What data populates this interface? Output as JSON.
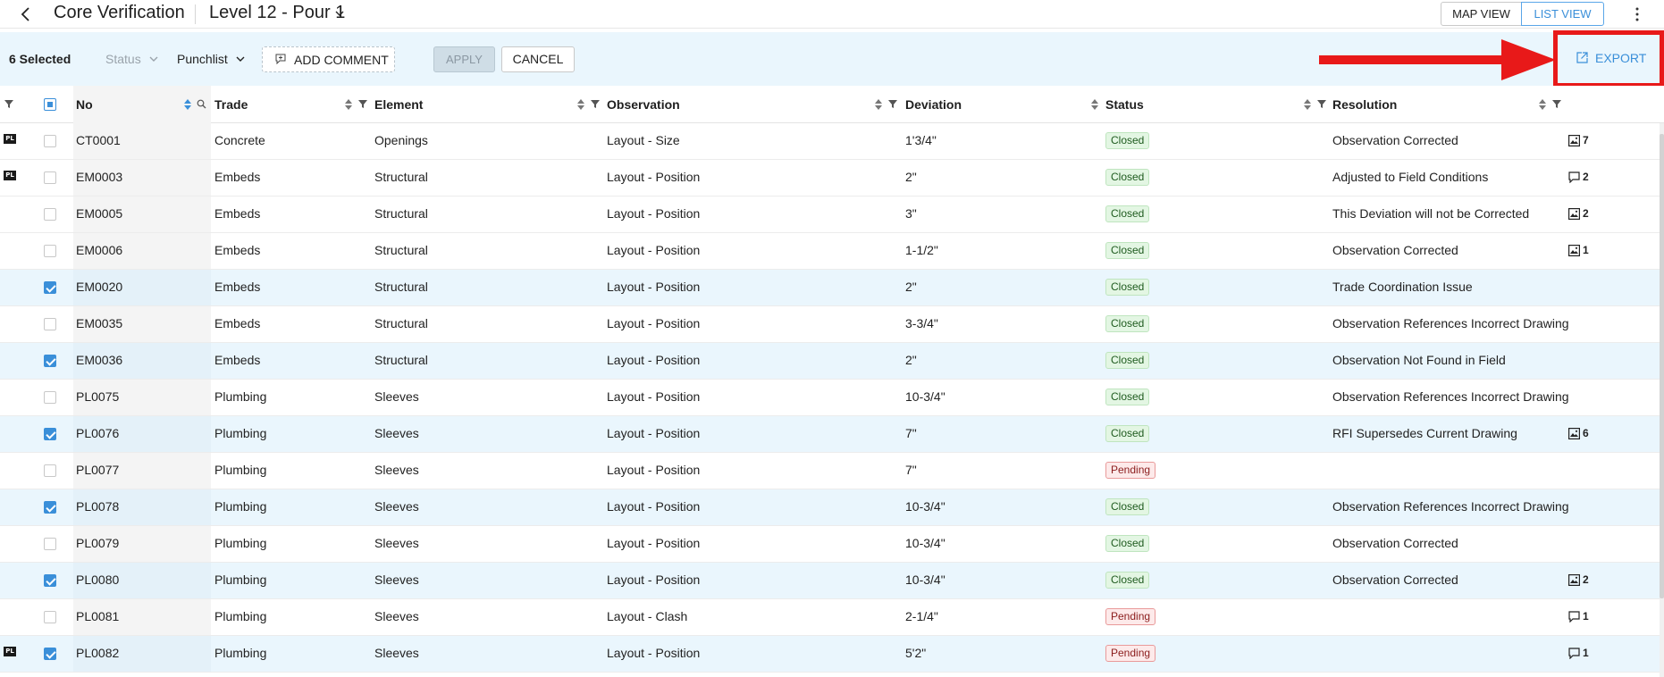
{
  "header": {
    "title": "Core Verification",
    "level": "Level 12 - Pour 1",
    "map_view": "MAP VIEW",
    "list_view": "LIST VIEW"
  },
  "toolbar": {
    "selected": "6 Selected",
    "status": "Status",
    "punchlist": "Punchlist",
    "add_comment": "ADD COMMENT",
    "apply": "APPLY",
    "cancel": "CANCEL",
    "export": "EXPORT"
  },
  "columns": [
    "No",
    "Trade",
    "Element",
    "Observation",
    "Deviation",
    "Status",
    "Resolution"
  ],
  "colors": {
    "accent": "#3a8fd9",
    "selected_row": "#eaf6fd",
    "closed_badge": "#e3f6e3",
    "pending_badge": "#fdeaea",
    "highlight_red": "#e81919"
  },
  "rows": [
    {
      "pl": true,
      "checked": false,
      "no": "CT0001",
      "trade": "Concrete",
      "element": "Openings",
      "observation": "Layout - Size",
      "deviation": "1'3/4\"",
      "status": "Closed",
      "resolution": "Observation Corrected",
      "att_icon": "image-icon",
      "att_count": "7"
    },
    {
      "pl": true,
      "checked": false,
      "no": "EM0003",
      "trade": "Embeds",
      "element": "Structural",
      "observation": "Layout - Position",
      "deviation": "2\"",
      "status": "Closed",
      "resolution": "Adjusted to Field Conditions",
      "att_icon": "comment-icon",
      "att_count": "2"
    },
    {
      "pl": false,
      "checked": false,
      "no": "EM0005",
      "trade": "Embeds",
      "element": "Structural",
      "observation": "Layout - Position",
      "deviation": "3\"",
      "status": "Closed",
      "resolution": "This Deviation will not be Corrected",
      "att_icon": "image-icon",
      "att_count": "2"
    },
    {
      "pl": false,
      "checked": false,
      "no": "EM0006",
      "trade": "Embeds",
      "element": "Structural",
      "observation": "Layout - Position",
      "deviation": "1-1/2\"",
      "status": "Closed",
      "resolution": "Observation Corrected",
      "att_icon": "image-icon",
      "att_count": "1"
    },
    {
      "pl": false,
      "checked": true,
      "no": "EM0020",
      "trade": "Embeds",
      "element": "Structural",
      "observation": "Layout - Position",
      "deviation": "2\"",
      "status": "Closed",
      "resolution": "Trade Coordination Issue",
      "att_icon": "",
      "att_count": ""
    },
    {
      "pl": false,
      "checked": false,
      "no": "EM0035",
      "trade": "Embeds",
      "element": "Structural",
      "observation": "Layout - Position",
      "deviation": "3-3/4\"",
      "status": "Closed",
      "resolution": "Observation References Incorrect Drawing",
      "att_icon": "",
      "att_count": ""
    },
    {
      "pl": false,
      "checked": true,
      "no": "EM0036",
      "trade": "Embeds",
      "element": "Structural",
      "observation": "Layout - Position",
      "deviation": "2\"",
      "status": "Closed",
      "resolution": "Observation Not Found in Field",
      "att_icon": "",
      "att_count": ""
    },
    {
      "pl": false,
      "checked": false,
      "no": "PL0075",
      "trade": "Plumbing",
      "element": "Sleeves",
      "observation": "Layout - Position",
      "deviation": "10-3/4\"",
      "status": "Closed",
      "resolution": "Observation References Incorrect Drawing",
      "att_icon": "",
      "att_count": ""
    },
    {
      "pl": false,
      "checked": true,
      "no": "PL0076",
      "trade": "Plumbing",
      "element": "Sleeves",
      "observation": "Layout - Position",
      "deviation": "7\"",
      "status": "Closed",
      "resolution": "RFI Supersedes Current Drawing",
      "att_icon": "image-icon",
      "att_count": "6"
    },
    {
      "pl": false,
      "checked": false,
      "no": "PL0077",
      "trade": "Plumbing",
      "element": "Sleeves",
      "observation": "Layout - Position",
      "deviation": "7\"",
      "status": "Pending",
      "resolution": "",
      "att_icon": "",
      "att_count": ""
    },
    {
      "pl": false,
      "checked": true,
      "no": "PL0078",
      "trade": "Plumbing",
      "element": "Sleeves",
      "observation": "Layout - Position",
      "deviation": "10-3/4\"",
      "status": "Closed",
      "resolution": "Observation References Incorrect Drawing",
      "att_icon": "",
      "att_count": ""
    },
    {
      "pl": false,
      "checked": false,
      "no": "PL0079",
      "trade": "Plumbing",
      "element": "Sleeves",
      "observation": "Layout - Position",
      "deviation": "10-3/4\"",
      "status": "Closed",
      "resolution": "Observation Corrected",
      "att_icon": "",
      "att_count": ""
    },
    {
      "pl": false,
      "checked": true,
      "no": "PL0080",
      "trade": "Plumbing",
      "element": "Sleeves",
      "observation": "Layout - Position",
      "deviation": "10-3/4\"",
      "status": "Closed",
      "resolution": "Observation Corrected",
      "att_icon": "image-icon",
      "att_count": "2"
    },
    {
      "pl": false,
      "checked": false,
      "no": "PL0081",
      "trade": "Plumbing",
      "element": "Sleeves",
      "observation": "Layout - Clash",
      "deviation": "2-1/4\"",
      "status": "Pending",
      "resolution": "",
      "att_icon": "comment-icon",
      "att_count": "1"
    },
    {
      "pl": true,
      "checked": true,
      "no": "PL0082",
      "trade": "Plumbing",
      "element": "Sleeves",
      "observation": "Layout - Position",
      "deviation": "5'2\"",
      "status": "Pending",
      "resolution": "",
      "att_icon": "comment-icon",
      "att_count": "1"
    }
  ]
}
